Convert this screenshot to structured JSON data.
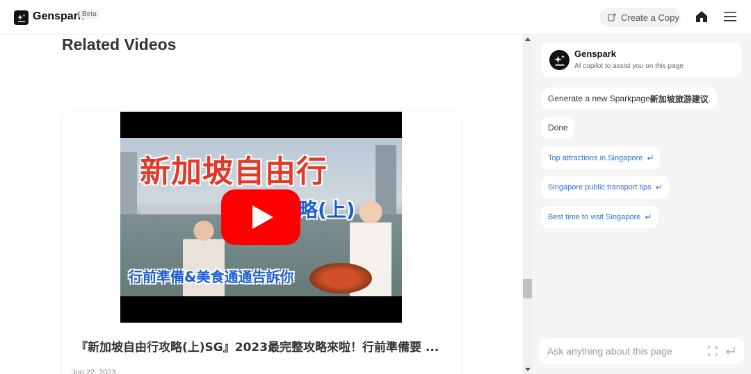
{
  "header": {
    "brand": "Genspark",
    "badge": "Beta",
    "create_copy_label": "Create a Copy"
  },
  "main": {
    "section_title": "Related Videos",
    "video": {
      "thumbnail_title": "新加坡自由行",
      "thumbnail_subtitle": "略(上)",
      "thumbnail_caption": "行前準備&美食通通告訴你",
      "title": "『新加坡自由行攻略(上)SG』2023最完整攻略來啦！行前準備要 ...",
      "date": "Jun 22, 2023"
    }
  },
  "copilot": {
    "name": "Genspark",
    "description": "AI copilot to assist you on this page",
    "messages": [
      {
        "text_prefix": "Generate a new Sparkpage ",
        "text_bold": "新加坡旅游建议",
        "text_suffix": "."
      },
      {
        "text": "Done"
      }
    ],
    "suggestions": [
      "Top attractions in Singapore",
      "Singapore public transport tips",
      "Best time to visit Singapore"
    ],
    "input_placeholder": "Ask anything about this page"
  },
  "colors": {
    "accent_link": "#2b6fd6",
    "youtube_red": "#ff0000",
    "panel_bg": "#f5f5f5"
  }
}
